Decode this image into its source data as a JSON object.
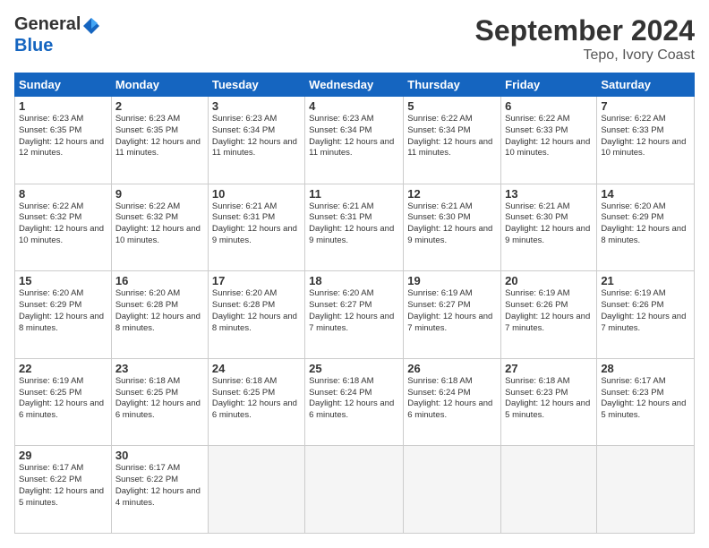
{
  "header": {
    "logo_general": "General",
    "logo_blue": "Blue",
    "month": "September 2024",
    "location": "Tepo, Ivory Coast"
  },
  "weekdays": [
    "Sunday",
    "Monday",
    "Tuesday",
    "Wednesday",
    "Thursday",
    "Friday",
    "Saturday"
  ],
  "weeks": [
    [
      {
        "day": "1",
        "sunrise": "6:23 AM",
        "sunset": "6:35 PM",
        "daylight": "12 hours and 12 minutes."
      },
      {
        "day": "2",
        "sunrise": "6:23 AM",
        "sunset": "6:35 PM",
        "daylight": "12 hours and 11 minutes."
      },
      {
        "day": "3",
        "sunrise": "6:23 AM",
        "sunset": "6:34 PM",
        "daylight": "12 hours and 11 minutes."
      },
      {
        "day": "4",
        "sunrise": "6:23 AM",
        "sunset": "6:34 PM",
        "daylight": "12 hours and 11 minutes."
      },
      {
        "day": "5",
        "sunrise": "6:22 AM",
        "sunset": "6:34 PM",
        "daylight": "12 hours and 11 minutes."
      },
      {
        "day": "6",
        "sunrise": "6:22 AM",
        "sunset": "6:33 PM",
        "daylight": "12 hours and 10 minutes."
      },
      {
        "day": "7",
        "sunrise": "6:22 AM",
        "sunset": "6:33 PM",
        "daylight": "12 hours and 10 minutes."
      }
    ],
    [
      {
        "day": "8",
        "sunrise": "6:22 AM",
        "sunset": "6:32 PM",
        "daylight": "12 hours and 10 minutes."
      },
      {
        "day": "9",
        "sunrise": "6:22 AM",
        "sunset": "6:32 PM",
        "daylight": "12 hours and 10 minutes."
      },
      {
        "day": "10",
        "sunrise": "6:21 AM",
        "sunset": "6:31 PM",
        "daylight": "12 hours and 9 minutes."
      },
      {
        "day": "11",
        "sunrise": "6:21 AM",
        "sunset": "6:31 PM",
        "daylight": "12 hours and 9 minutes."
      },
      {
        "day": "12",
        "sunrise": "6:21 AM",
        "sunset": "6:30 PM",
        "daylight": "12 hours and 9 minutes."
      },
      {
        "day": "13",
        "sunrise": "6:21 AM",
        "sunset": "6:30 PM",
        "daylight": "12 hours and 9 minutes."
      },
      {
        "day": "14",
        "sunrise": "6:20 AM",
        "sunset": "6:29 PM",
        "daylight": "12 hours and 8 minutes."
      }
    ],
    [
      {
        "day": "15",
        "sunrise": "6:20 AM",
        "sunset": "6:29 PM",
        "daylight": "12 hours and 8 minutes."
      },
      {
        "day": "16",
        "sunrise": "6:20 AM",
        "sunset": "6:28 PM",
        "daylight": "12 hours and 8 minutes."
      },
      {
        "day": "17",
        "sunrise": "6:20 AM",
        "sunset": "6:28 PM",
        "daylight": "12 hours and 8 minutes."
      },
      {
        "day": "18",
        "sunrise": "6:20 AM",
        "sunset": "6:27 PM",
        "daylight": "12 hours and 7 minutes."
      },
      {
        "day": "19",
        "sunrise": "6:19 AM",
        "sunset": "6:27 PM",
        "daylight": "12 hours and 7 minutes."
      },
      {
        "day": "20",
        "sunrise": "6:19 AM",
        "sunset": "6:26 PM",
        "daylight": "12 hours and 7 minutes."
      },
      {
        "day": "21",
        "sunrise": "6:19 AM",
        "sunset": "6:26 PM",
        "daylight": "12 hours and 7 minutes."
      }
    ],
    [
      {
        "day": "22",
        "sunrise": "6:19 AM",
        "sunset": "6:25 PM",
        "daylight": "12 hours and 6 minutes."
      },
      {
        "day": "23",
        "sunrise": "6:18 AM",
        "sunset": "6:25 PM",
        "daylight": "12 hours and 6 minutes."
      },
      {
        "day": "24",
        "sunrise": "6:18 AM",
        "sunset": "6:25 PM",
        "daylight": "12 hours and 6 minutes."
      },
      {
        "day": "25",
        "sunrise": "6:18 AM",
        "sunset": "6:24 PM",
        "daylight": "12 hours and 6 minutes."
      },
      {
        "day": "26",
        "sunrise": "6:18 AM",
        "sunset": "6:24 PM",
        "daylight": "12 hours and 6 minutes."
      },
      {
        "day": "27",
        "sunrise": "6:18 AM",
        "sunset": "6:23 PM",
        "daylight": "12 hours and 5 minutes."
      },
      {
        "day": "28",
        "sunrise": "6:17 AM",
        "sunset": "6:23 PM",
        "daylight": "12 hours and 5 minutes."
      }
    ],
    [
      {
        "day": "29",
        "sunrise": "6:17 AM",
        "sunset": "6:22 PM",
        "daylight": "12 hours and 5 minutes."
      },
      {
        "day": "30",
        "sunrise": "6:17 AM",
        "sunset": "6:22 PM",
        "daylight": "12 hours and 4 minutes."
      },
      null,
      null,
      null,
      null,
      null
    ]
  ]
}
